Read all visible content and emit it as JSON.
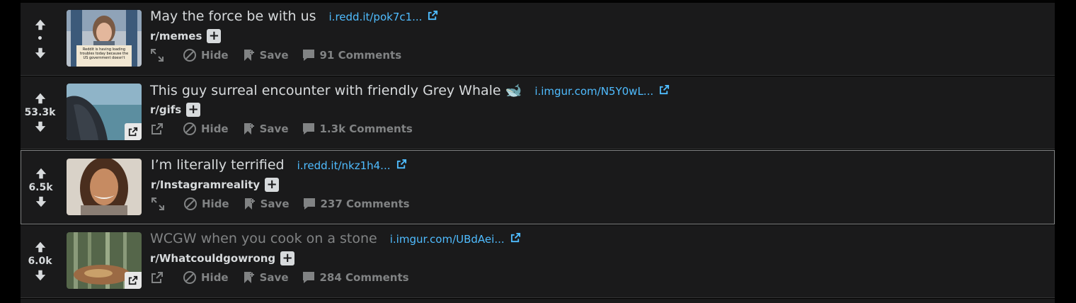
{
  "colors": {
    "bg": "#1a1a1b",
    "text": "#d7dadc",
    "muted": "#818384",
    "link": "#4fbcff"
  },
  "actions": {
    "hide": "Hide",
    "save": "Save"
  },
  "posts": [
    {
      "score": "•",
      "title": "May the force be with us",
      "domain": "i.redd.it/pok7c1...",
      "subreddit": "r/memes",
      "comments": "91 Comments",
      "expand_icon": "expand-icon",
      "thumb_sign_text": "Reddit is having loading troubles today because the US government doesn't"
    },
    {
      "score": "53.3k",
      "title": "This guy surreal encounter with friendly Grey Whale 🐋",
      "domain": "i.imgur.com/N5Y0wL...",
      "subreddit": "r/gifs",
      "comments": "1.3k Comments",
      "expand_icon": "external-link-icon"
    },
    {
      "score": "6.5k",
      "title": "I’m literally terrified",
      "domain": "i.redd.it/nkz1h4...",
      "subreddit": "r/Instagramreality",
      "comments": "237 Comments",
      "expand_icon": "expand-icon"
    },
    {
      "score": "6.0k",
      "title": "WCGW when you cook on a stone",
      "domain": "i.imgur.com/UBdAei...",
      "subreddit": "r/Whatcouldgowrong",
      "comments": "284 Comments",
      "expand_icon": "external-link-icon"
    }
  ]
}
